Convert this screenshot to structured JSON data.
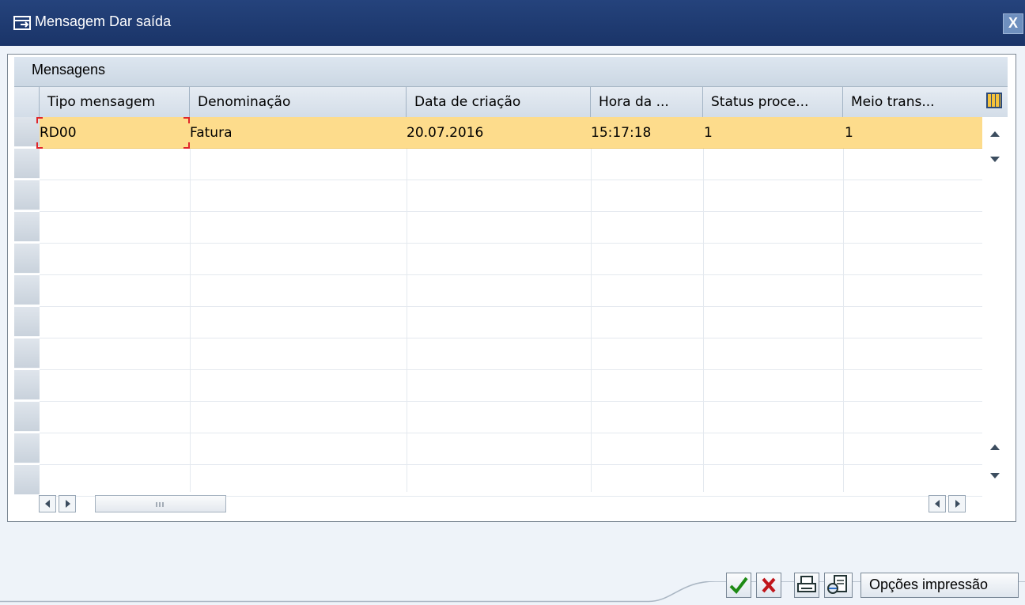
{
  "window": {
    "title": "Mensagem Dar saída",
    "close_label": "X"
  },
  "panel": {
    "title": "Mensagens"
  },
  "table": {
    "columns": [
      "Tipo mensagem",
      "Denominação",
      "Data de criação",
      "Hora da ...",
      "Status proce...",
      "Meio trans..."
    ],
    "rows": [
      [
        "RD00",
        "Fatura",
        "20.07.2016",
        "15:17:18",
        "1",
        "1"
      ]
    ],
    "empty_rows": 11
  },
  "footer": {
    "print_options_label": "Opções impressão"
  },
  "colors": {
    "title_bar": "#1f3b72",
    "selected_row": "#fddc8c",
    "accent_green": "#1e8a14",
    "accent_red": "#c0151a"
  }
}
